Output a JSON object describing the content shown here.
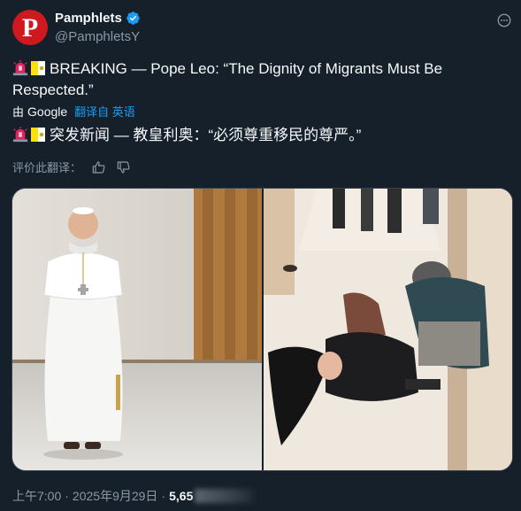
{
  "account": {
    "avatar_letter": "P",
    "avatar_color": "#d0181f",
    "name": "Pamphlets",
    "handle": "@PamphletsY",
    "verified_icon": "verified-badge-icon"
  },
  "tweet": {
    "text_en": "BREAKING — Pope Leo: “The Dignity of Migrants Must Be Respected.”",
    "translated_by_prefix": "由",
    "translated_by_service": "Google",
    "translated_from_label": "翻译自 英语",
    "text_zh": "突发新闻 — 教皇利奥：“必须尊重移民的尊严。”",
    "rate_translation_label": "评价此翻译：",
    "emoji": [
      "siren-emoji",
      "vatican-flag-emoji"
    ]
  },
  "media": {
    "left_photo": "pope-walking-photo",
    "right_photo": "woman-on-floor-photo"
  },
  "footer": {
    "time": "上午7:00",
    "separator": "·",
    "date": "2025年9月29日",
    "views": "5,65"
  },
  "colors": {
    "background": "#15202b",
    "text": "#f7f9f9",
    "secondary": "#8b98a5",
    "link": "#1d9bf0",
    "border": "#38444d"
  }
}
